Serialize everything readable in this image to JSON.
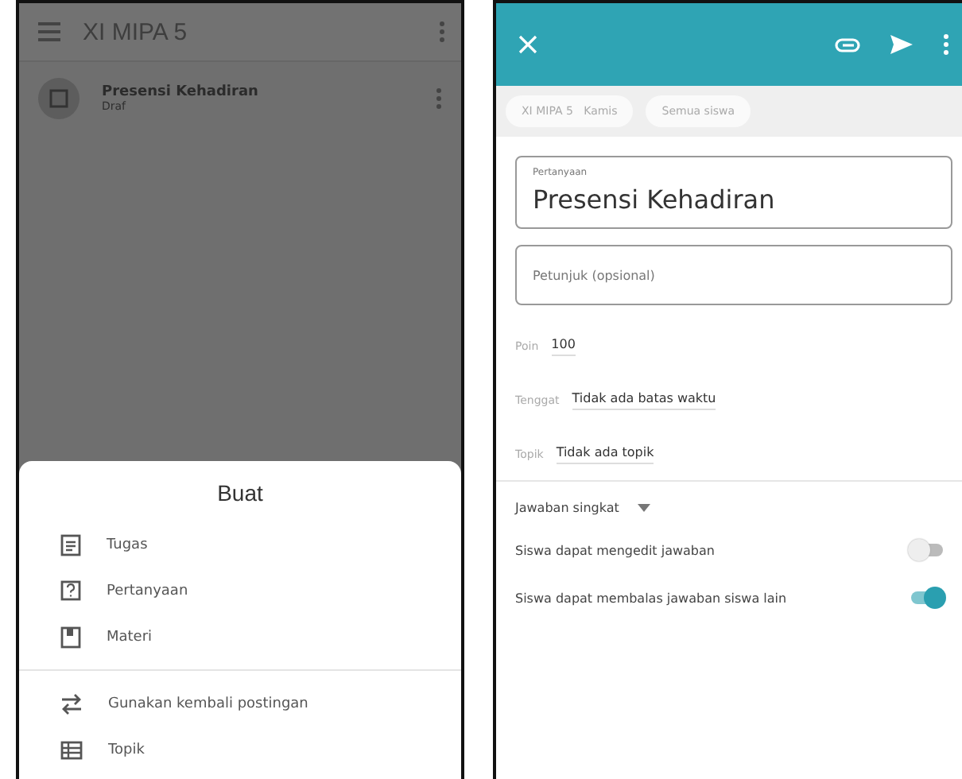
{
  "class_screen": {
    "app_bar": {
      "title": "XI MIPA 5"
    },
    "post": {
      "title": "Presensi Kehadiran",
      "status": "Draf"
    },
    "sheet": {
      "title": "Buat",
      "groups": [
        [
          {
            "label": "Tugas",
            "kind": "assignment"
          },
          {
            "label": "Pertanyaan",
            "kind": "question"
          },
          {
            "label": "Materi",
            "kind": "material"
          }
        ],
        [
          {
            "label": "Gunakan kembali postingan",
            "kind": "reuse"
          },
          {
            "label": "Topik",
            "kind": "topic"
          }
        ]
      ]
    }
  },
  "question_screen": {
    "chips": [
      "XI MIPA 5   Kamis",
      "Semua siswa"
    ],
    "question_field": {
      "label": "Pertanyaan",
      "value": "Presensi Kehadiran"
    },
    "instructions_field": {
      "placeholder": "Petunjuk (opsional)"
    },
    "settings": [
      {
        "label": "Poin",
        "value": "100"
      },
      {
        "label": "Tenggat",
        "value": "Tidak ada batas waktu"
      },
      {
        "label": "Topik",
        "value": "Tidak ada topik"
      }
    ],
    "answer_type": "Jawaban singkat",
    "toggles": [
      {
        "label": "Siswa dapat mengedit jawaban",
        "on": false
      },
      {
        "label": "Siswa dapat membalas jawaban siswa lain",
        "on": true
      }
    ]
  }
}
